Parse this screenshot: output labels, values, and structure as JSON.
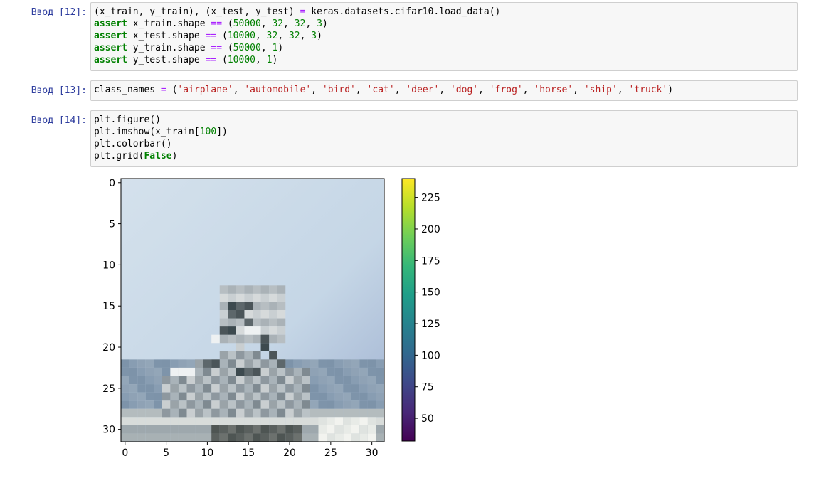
{
  "cells": [
    {
      "prompt": "Ввод [12]:",
      "lines": [
        [
          [
            "t",
            "(x_train, y_train), (x_test, y_test) "
          ],
          [
            "op",
            "="
          ],
          [
            "t",
            " keras.datasets.cifar10.load_data()"
          ]
        ],
        [
          [
            "kw",
            "assert"
          ],
          [
            "t",
            " x_train.shape "
          ],
          [
            "op",
            "=="
          ],
          [
            "t",
            " ("
          ],
          [
            "num",
            "50000"
          ],
          [
            "t",
            ", "
          ],
          [
            "num",
            "32"
          ],
          [
            "t",
            ", "
          ],
          [
            "num",
            "32"
          ],
          [
            "t",
            ", "
          ],
          [
            "num",
            "3"
          ],
          [
            "t",
            ")"
          ]
        ],
        [
          [
            "kw",
            "assert"
          ],
          [
            "t",
            " x_test.shape "
          ],
          [
            "op",
            "=="
          ],
          [
            "t",
            " ("
          ],
          [
            "num",
            "10000"
          ],
          [
            "t",
            ", "
          ],
          [
            "num",
            "32"
          ],
          [
            "t",
            ", "
          ],
          [
            "num",
            "32"
          ],
          [
            "t",
            ", "
          ],
          [
            "num",
            "3"
          ],
          [
            "t",
            ")"
          ]
        ],
        [
          [
            "kw",
            "assert"
          ],
          [
            "t",
            " y_train.shape "
          ],
          [
            "op",
            "=="
          ],
          [
            "t",
            " ("
          ],
          [
            "num",
            "50000"
          ],
          [
            "t",
            ", "
          ],
          [
            "num",
            "1"
          ],
          [
            "t",
            ")"
          ]
        ],
        [
          [
            "kw",
            "assert"
          ],
          [
            "t",
            " y_test.shape "
          ],
          [
            "op",
            "=="
          ],
          [
            "t",
            " ("
          ],
          [
            "num",
            "10000"
          ],
          [
            "t",
            ", "
          ],
          [
            "num",
            "1"
          ],
          [
            "t",
            ")"
          ]
        ]
      ]
    },
    {
      "prompt": "Ввод [13]:",
      "lines": [
        [
          [
            "t",
            "class_names "
          ],
          [
            "op",
            "="
          ],
          [
            "t",
            " ("
          ],
          [
            "str",
            "'airplane'"
          ],
          [
            "t",
            ", "
          ],
          [
            "str",
            "'automobile'"
          ],
          [
            "t",
            ", "
          ],
          [
            "str",
            "'bird'"
          ],
          [
            "t",
            ", "
          ],
          [
            "str",
            "'cat'"
          ],
          [
            "t",
            ", "
          ],
          [
            "str",
            "'deer'"
          ],
          [
            "t",
            ", "
          ],
          [
            "str",
            "'dog'"
          ],
          [
            "t",
            ", "
          ],
          [
            "str",
            "'frog'"
          ],
          [
            "t",
            ", "
          ],
          [
            "str",
            "'horse'"
          ],
          [
            "t",
            ", "
          ],
          [
            "str",
            "'ship'"
          ],
          [
            "t",
            ", "
          ],
          [
            "str",
            "'truck'"
          ],
          [
            "t",
            ")"
          ]
        ]
      ]
    },
    {
      "prompt": "Ввод [14]:",
      "lines": [
        [
          [
            "t",
            "plt.figure()"
          ]
        ],
        [
          [
            "t",
            "plt.imshow(x_train["
          ],
          [
            "num",
            "100"
          ],
          [
            "t",
            "])"
          ]
        ],
        [
          [
            "t",
            "plt.colorbar()"
          ]
        ],
        [
          [
            "t",
            "plt.grid("
          ],
          [
            "kw",
            "False"
          ],
          [
            "t",
            ")"
          ]
        ]
      ]
    }
  ],
  "chart_data": {
    "type": "heatmap",
    "title": "",
    "xlabel": "",
    "ylabel": "",
    "image_size": [
      32,
      32
    ],
    "xlim": [
      -0.5,
      31.5
    ],
    "ylim": [
      31.5,
      -0.5
    ],
    "x_ticks": [
      "0",
      "5",
      "10",
      "15",
      "20",
      "25",
      "30"
    ],
    "y_ticks": [
      "0",
      "5",
      "10",
      "15",
      "20",
      "25",
      "30"
    ],
    "grid": false,
    "colorbar": {
      "colormap": "viridis",
      "range": [
        32,
        240
      ],
      "ticks": [
        "50",
        "75",
        "100",
        "125",
        "150",
        "175",
        "200",
        "225"
      ],
      "colors": [
        "#440154",
        "#482878",
        "#3e4989",
        "#31688e",
        "#26828e",
        "#1f9e89",
        "#35b779",
        "#6ece58",
        "#b5de2b",
        "#fde725"
      ]
    }
  }
}
